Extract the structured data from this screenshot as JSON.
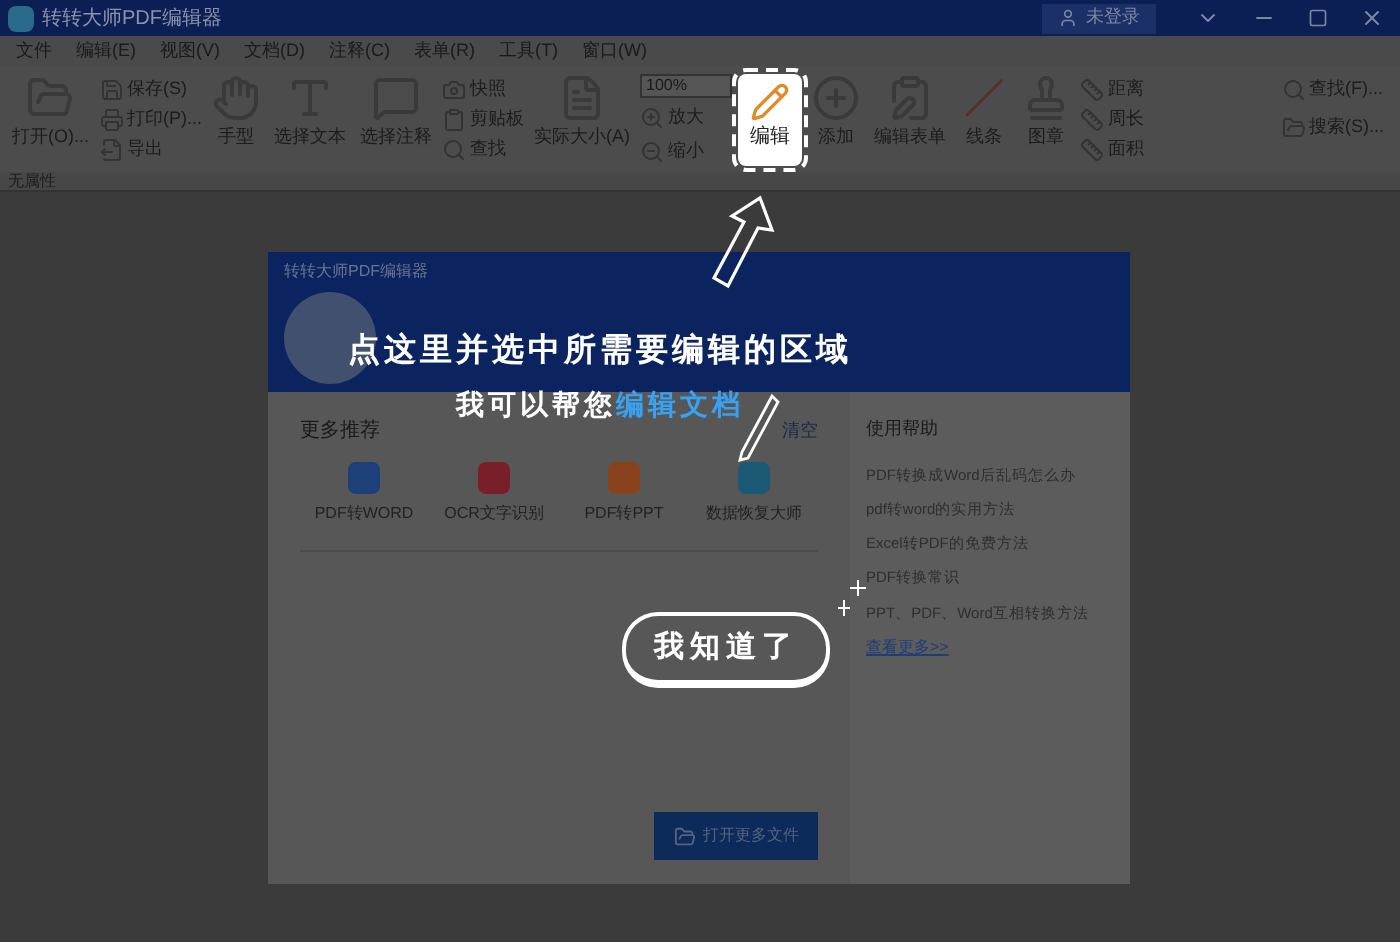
{
  "window": {
    "title": "转转大师PDF编辑器",
    "user": "未登录"
  },
  "menu": [
    "文件",
    "编辑(E)",
    "视图(V)",
    "文档(D)",
    "注释(C)",
    "表单(R)",
    "工具(T)",
    "窗口(W)"
  ],
  "ribbon": {
    "open": "打开(O)...",
    "file_actions": [
      "保存(S)",
      "打印(P)...",
      "导出"
    ],
    "tools": [
      "手型",
      "选择文本",
      "选择注释"
    ],
    "clip": [
      "快照",
      "剪贴板",
      "查找"
    ],
    "actual_size": "实际大小(A)",
    "zoom": {
      "value": "100%",
      "zoom_in": "放大",
      "zoom_out": "缩小"
    },
    "edit": {
      "label": "编辑",
      "highlighted": true
    },
    "add": "添加",
    "edit_form": "编辑表单",
    "lines": "线条",
    "stamp": "图章",
    "measure": [
      "距离",
      "周长",
      "面积"
    ],
    "quick": [
      "查找(F)...",
      "搜索(S)..."
    ]
  },
  "property_bar": "无属性",
  "dialog": {
    "title": "转转大师PDF编辑器",
    "section": "更多推荐",
    "clear": "清空",
    "apps": [
      {
        "label": "PDF转WORD",
        "color": "#1d3f7a"
      },
      {
        "label": "OCR文字识别",
        "color": "#7a1f2a"
      },
      {
        "label": "PDF转PPT",
        "color": "#8a421c"
      },
      {
        "label": "数据恢复大师",
        "color": "#1b5a75"
      }
    ],
    "help_title": "使用帮助",
    "help_links": [
      "PDF转换成Word后乱码怎么办",
      "pdf转word的实用方法",
      "Excel转PDF的免费方法",
      "PDF转换常识",
      "PPT、PDF、Word互相转换方法"
    ],
    "more": "查看更多>>",
    "open_button": "打开更多文件"
  },
  "guide": {
    "line1": "点这里并选中所需要编辑的区域",
    "line2_prefix": "我可以帮您",
    "line2_highlight": "编辑文档",
    "button": "我知道了"
  }
}
